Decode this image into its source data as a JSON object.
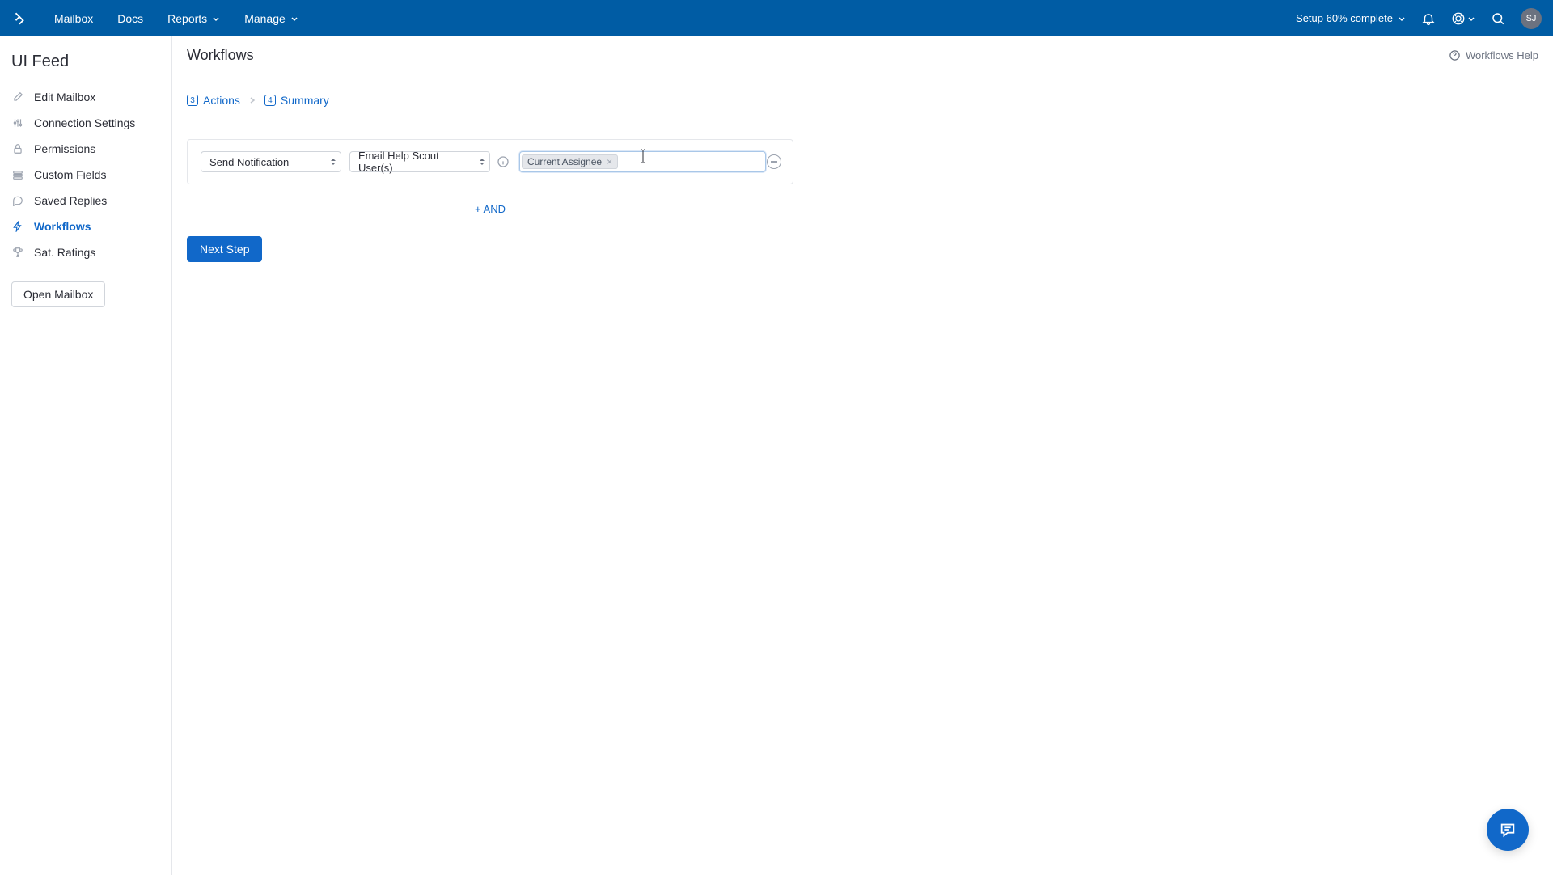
{
  "topnav": {
    "items": [
      "Mailbox",
      "Docs",
      "Reports",
      "Manage"
    ],
    "setup_status": "Setup 60% complete",
    "avatar_initials": "SJ"
  },
  "sidebar": {
    "title": "UI Feed",
    "items": [
      {
        "label": "Edit Mailbox"
      },
      {
        "label": "Connection Settings"
      },
      {
        "label": "Permissions"
      },
      {
        "label": "Custom Fields"
      },
      {
        "label": "Saved Replies"
      },
      {
        "label": "Workflows"
      },
      {
        "label": "Sat. Ratings"
      }
    ],
    "open_mailbox": "Open Mailbox"
  },
  "page": {
    "title": "Workflows",
    "help_label": "Workflows Help"
  },
  "breadcrumb": {
    "step3": {
      "num": "3",
      "label": "Actions"
    },
    "step4": {
      "num": "4",
      "label": "Summary"
    }
  },
  "action_row": {
    "select1_value": "Send Notification",
    "select2_value": "Email Help Scout User(s)",
    "tag_value": "Current Assignee"
  },
  "and_label": "+ AND",
  "next_button": "Next Step"
}
